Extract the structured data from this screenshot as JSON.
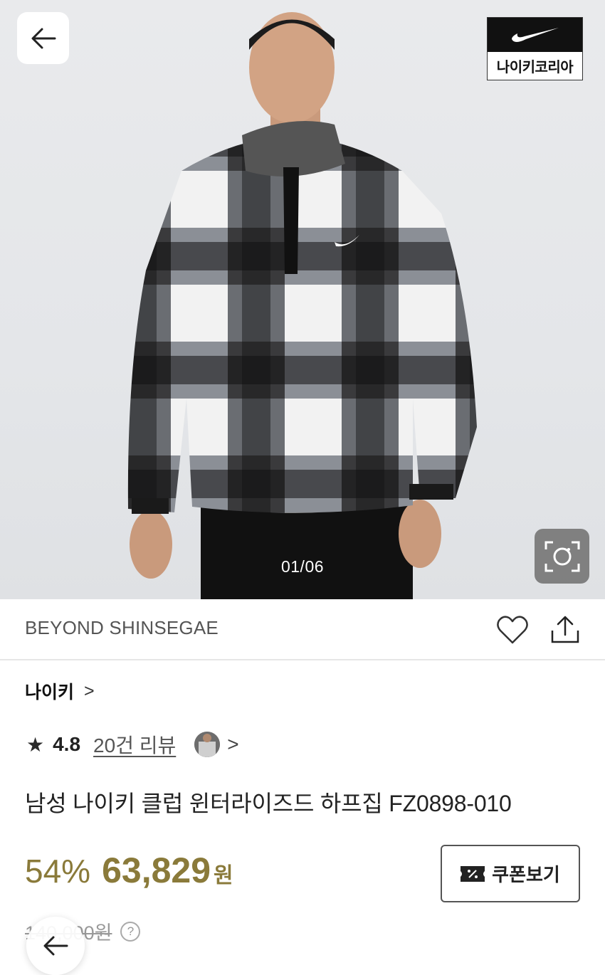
{
  "hero": {
    "counter": "01/06",
    "brand_badge_text": "나이키코리아"
  },
  "store": {
    "name": "BEYOND SHINSEGAE"
  },
  "brand": {
    "name": "나이키",
    "chevron": ">"
  },
  "rating": {
    "star": "★",
    "score": "4.8",
    "reviews": "20건 리뷰",
    "chevron": ">"
  },
  "product": {
    "title": "남성 나이키 클럽 윈터라이즈드 하프집 FZ0898-010",
    "discount": "54%",
    "price": "63,829",
    "currency": "원",
    "original_price": "140,000원",
    "help": "?"
  },
  "coupon": {
    "label": "쿠폰보기"
  },
  "colors": {
    "accent_gold": "#8a7a3a"
  }
}
